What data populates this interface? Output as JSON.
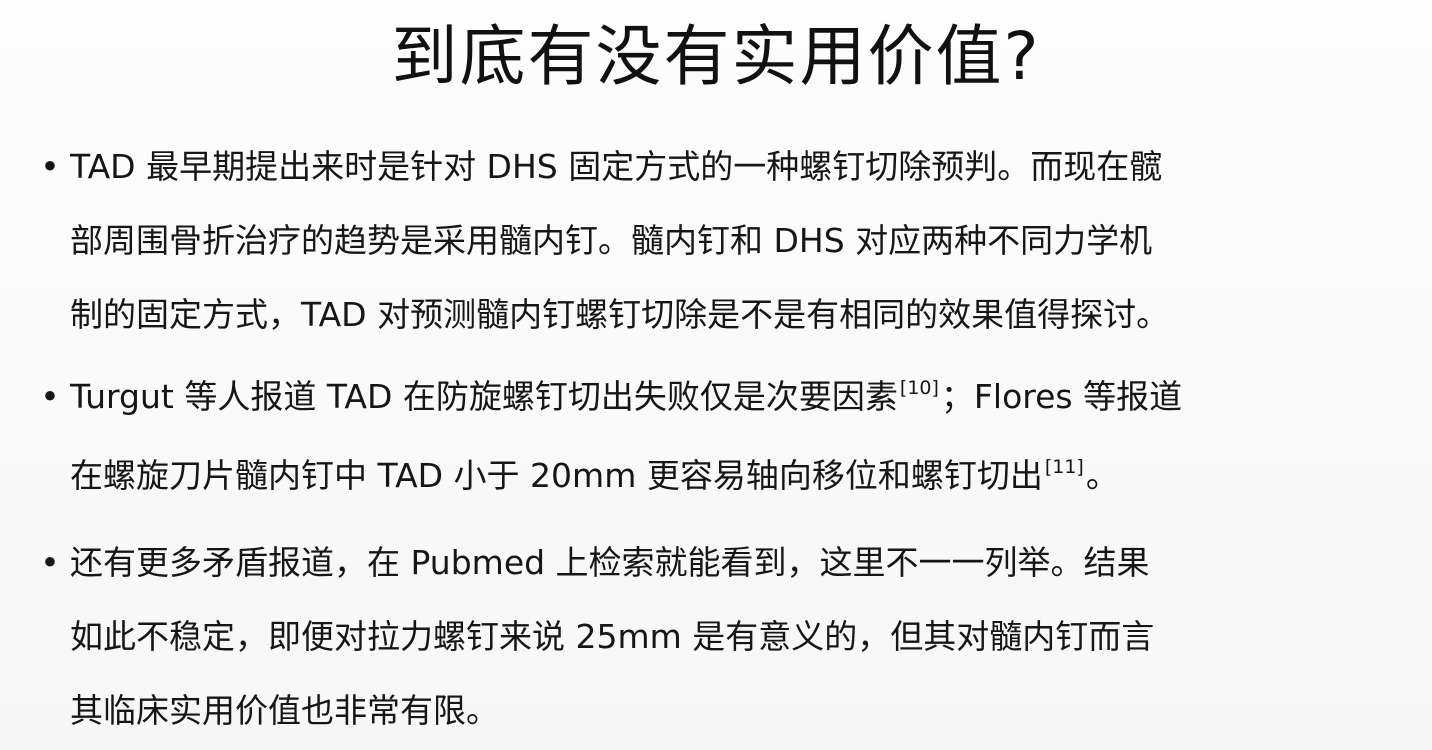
{
  "title": "到底有没有实用价值?",
  "bullets": [
    {
      "lines": [
        "TAD 最早期提出来时是针对 DHS 固定方式的一种螺钉切除预判。而现在髋",
        "部周围骨折治疗的趋势是采用髓内钉。髓内钉和 DHS 对应两种不同力学机",
        "制的固定方式，TAD 对预测髓内钉螺钉切除是不是有相同的效果值得探讨。"
      ]
    },
    {
      "line1_a": "Turgut 等人报道 TAD 在防旋螺钉切出失败仅是次要因素",
      "ref1": "[10]",
      "line1_b": "；Flores 等报道",
      "line2_a": "在螺旋刀片髓内钉中 TAD 小于 20mm 更容易轴向移位和螺钉切出",
      "ref2": "[11]",
      "line2_b": "。"
    },
    {
      "lines": [
        "还有更多矛盾报道，在 Pubmed 上检索就能看到，这里不一一列举。结果",
        "如此不稳定，即便对拉力螺钉来说 25mm 是有意义的，但其对髓内钉而言",
        "其临床实用价值也非常有限。"
      ]
    }
  ]
}
